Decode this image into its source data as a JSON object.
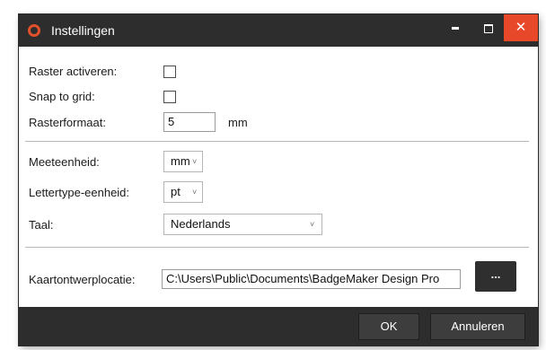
{
  "window": {
    "title": "Instellingen",
    "minimize_label": "–",
    "maximize_label": "□",
    "close_label": "✕",
    "accent": "#e8482a"
  },
  "settings": {
    "grid_enable_label": "Raster activeren:",
    "grid_enable_checked": false,
    "snap_label": "Snap to grid:",
    "snap_checked": false,
    "grid_size_label": "Rasterformaat:",
    "grid_size_value": "5",
    "grid_size_unit": "mm",
    "measure_unit_label": "Meeteenheid:",
    "measure_unit_value": "mm",
    "font_unit_label": "Lettertype-eenheid:",
    "font_unit_value": "pt",
    "language_label": "Taal:",
    "language_value": "Nederlands",
    "location_label": "Kaartontwerplocatie:",
    "location_value": "C:\\Users\\Public\\Documents\\BadgeMaker Design Pro",
    "browse_label": "..."
  },
  "footer": {
    "ok_label": "OK",
    "cancel_label": "Annuleren"
  }
}
